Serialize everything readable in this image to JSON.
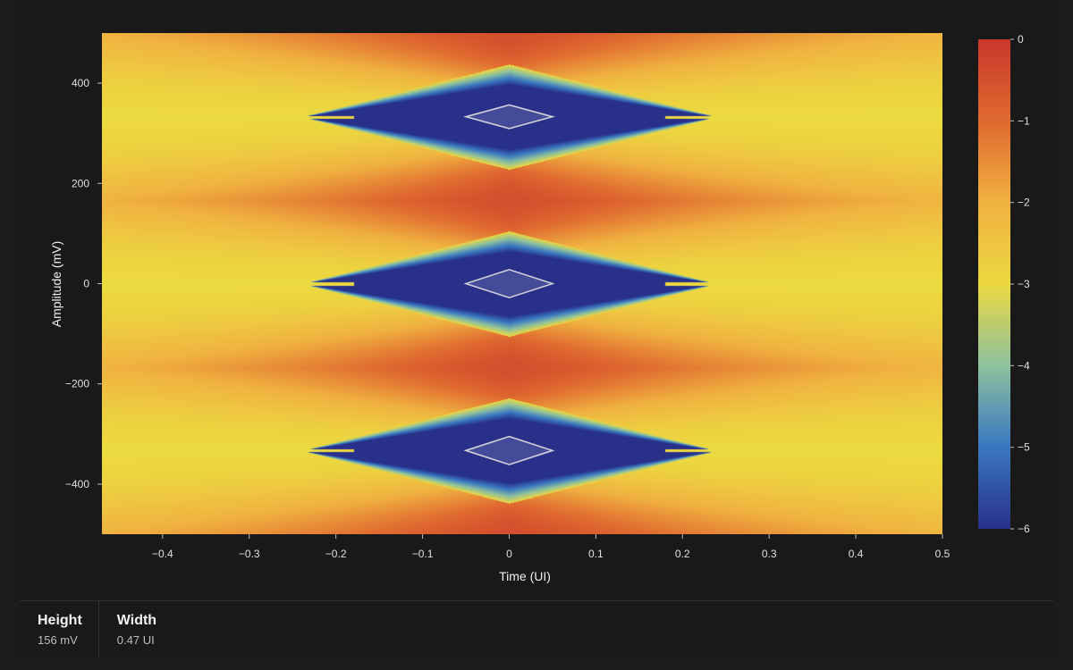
{
  "chart_data": {
    "type": "heatmap",
    "title": "",
    "xlabel": "Time (UI)",
    "ylabel": "Amplitude (mV)",
    "xlim": [
      -0.47,
      0.5
    ],
    "ylim": [
      -500,
      500
    ],
    "x_ticks": [
      -0.4,
      -0.3,
      -0.2,
      -0.1,
      0,
      0.1,
      0.2,
      0.3,
      0.4,
      0.5
    ],
    "x_tick_labels": [
      "−0.4",
      "−0.3",
      "−0.2",
      "−0.1",
      "0",
      "0.1",
      "0.2",
      "0.3",
      "0.4",
      "0.5"
    ],
    "y_ticks": [
      400,
      200,
      0,
      -200,
      -400
    ],
    "y_tick_labels": [
      "400",
      "200",
      "0",
      "−200",
      "−400"
    ],
    "colorbar": {
      "range": [
        -6,
        0
      ],
      "ticks": [
        0,
        -1,
        -2,
        -3,
        -4,
        -5,
        -6
      ],
      "tick_labels": [
        "0",
        "−1",
        "−2",
        "−3",
        "−4",
        "−5",
        "−6"
      ],
      "colors": [
        "#28308a",
        "#3a78c0",
        "#8cc0a0",
        "#ecd840",
        "#f0b040",
        "#e06a30",
        "#c8372a"
      ]
    },
    "eye_levels_mV": [
      333,
      0,
      -333
    ],
    "eyes": [
      {
        "center_ui": 0,
        "center_mV": 333,
        "height_mV": 47,
        "width_ui": 0.1
      },
      {
        "center_ui": 0,
        "center_mV": 0,
        "height_mV": 56,
        "width_ui": 0.1
      },
      {
        "center_ui": 0,
        "center_mV": -333,
        "height_mV": 56,
        "width_ui": 0.1
      }
    ],
    "grid": false
  },
  "stats": {
    "height": {
      "label": "Height",
      "value": "156 mV"
    },
    "width": {
      "label": "Width",
      "value": "0.47 UI"
    }
  }
}
